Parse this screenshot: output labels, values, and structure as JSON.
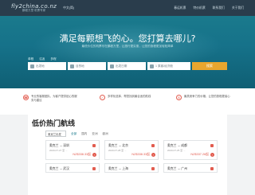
{
  "topbar": {
    "logo_main": "fly2china.co.nz",
    "logo_sub": "鹏程万里·机票专家",
    "lang": "中文(简)",
    "nav": [
      "春运机票",
      "特价机票",
      "联系我们",
      "关于我们"
    ]
  },
  "hero": {
    "title": "满足每颗想飞的心。您打算去哪儿?",
    "subtitle": "最低价位的机票尽在鹏程万里，让旅行更实惠，让您的旅程更加轻松简单",
    "trip_types": [
      "单程",
      "往返",
      "多程"
    ],
    "from_placeholder": "出发地",
    "to_placeholder": "目的地",
    "date_placeholder": "出发日期",
    "pax_value": "1 乘客/经济舱",
    "search_label": "搜索"
  },
  "features": [
    {
      "icon": "headset-icon",
      "text": "专业的客服团队，为客户提供贴心的服务与建议"
    },
    {
      "icon": "check-icon",
      "text": "多样化选择，帮您找到最合适的航线"
    },
    {
      "icon": "price-icon",
      "text": "最具竞争力的价格，让您的旅程更省心"
    }
  ],
  "routes_section": {
    "title": "低价热门航线",
    "origin_select": "奥克兰出发",
    "tabs": [
      "全部",
      "国内",
      "亚洲",
      "欧洲"
    ],
    "cards": [
      {
        "route": "奥克兰 → 深圳",
        "date": "2020-07-27 至 ...",
        "price": "NZ$338.33起"
      },
      {
        "route": "奥克兰 → 北京",
        "date": "2020-07-28 至 ...",
        "price": "NZ$338.33起"
      },
      {
        "route": "奥克兰 → 成都",
        "date": "2020-07-25 至 ...",
        "price": "NZ$337.28起"
      },
      {
        "route": "奥克兰 → 武汉",
        "date": "",
        "price": ""
      },
      {
        "route": "奥克兰 → 上海",
        "date": "",
        "price": ""
      },
      {
        "route": "奥克兰 → 广州",
        "date": "",
        "price": ""
      }
    ]
  },
  "colors": {
    "hero": "#16728a",
    "accent": "#e25c4f",
    "search_button": "#e8a62e"
  }
}
